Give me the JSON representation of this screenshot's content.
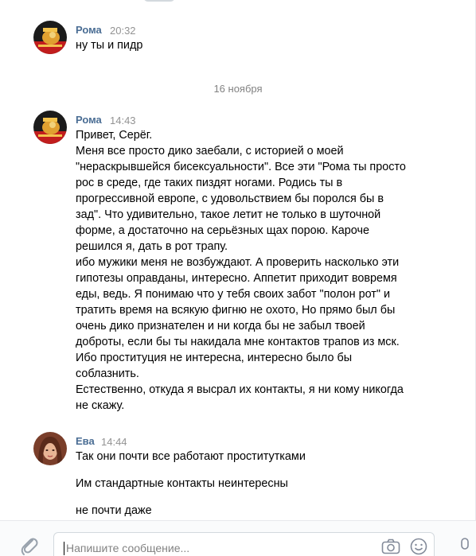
{
  "messages": [
    {
      "author": "Рома",
      "time": "20:32",
      "lines": [
        "ну ты и пидр"
      ]
    },
    {
      "author": "Рома",
      "time": "14:43",
      "lines": [
        "Привет, Серёг.",
        "Меня все просто дико заебали, с историей о моей",
        "\"нераскрывшейся бисексуальности\". Все эти \"Рома ты просто",
        "рос в среде, где таких пиздят ногами. Родись ты в",
        "прогрессивной европе, с удовольствием бы поролся бы в",
        "зад\". Что удивительно, такое летит не только в шуточной",
        "форме, а достаточно на серьёзных щах порою. Кароче",
        "решился я, дать в рот трапу.",
        "ибо мужики меня не возбуждают. А проверить насколько эти",
        "гипотезы оправданы, интересно. Аппетит приходит вовремя",
        "еды, ведь. Я понимаю что у тебя своих забот \"полон рот\" и",
        "тратить время на всякую фигню не охото, Но прямо был бы",
        "очень дико признателен и ни когда бы не забыл твоей",
        "доброты, если бы ты накидала мне контактов трапов из мск.",
        "Ибо проституция не интересна, интересно было бы",
        "соблазнить.",
        "Естественно, откуда я высрал их контакты, я ни кому никогда",
        "не скажу."
      ]
    },
    {
      "author": "Ева",
      "time": "14:44",
      "lines": [
        "Так они почти все работают проститутками",
        "Им стандартные контакты неинтересны",
        "не почти даже"
      ]
    }
  ],
  "date_separator": "16 ноября",
  "composer": {
    "placeholder": "Напишите сообщение..."
  },
  "colors": {
    "author": "#4a6d94",
    "time": "#939393",
    "border": "#e7e8ec"
  },
  "icons": [
    "paperclip-icon",
    "camera-icon",
    "smile-icon",
    "microphone-icon"
  ]
}
